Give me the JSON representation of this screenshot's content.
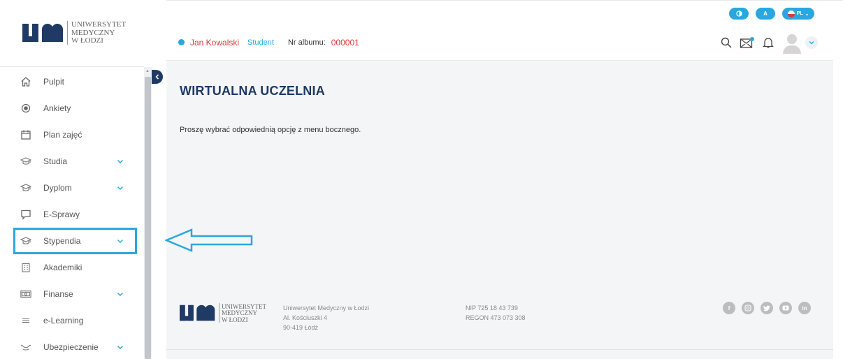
{
  "brand": {
    "logo_um": "um",
    "name_lines": [
      "UNIWERSYTET",
      "MEDYCZNY",
      "W ŁODZI"
    ]
  },
  "top_toggles": {
    "contrast_icon": "contrast-icon",
    "font_label": "A",
    "language": "PL"
  },
  "header": {
    "user_name": "Jan Kowalski",
    "user_role": "Student",
    "album_label": "Nr albumu:",
    "album_number": "000001",
    "icons": [
      "search-icon",
      "mail-icon",
      "bell-icon",
      "avatar"
    ]
  },
  "sidebar": {
    "items": [
      {
        "label": "Pulpit",
        "icon": "home-icon",
        "expandable": false
      },
      {
        "label": "Ankiety",
        "icon": "radio-icon",
        "expandable": false
      },
      {
        "label": "Plan zajęć",
        "icon": "calendar-icon",
        "expandable": false
      },
      {
        "label": "Studia",
        "icon": "graduation-cap-icon",
        "expandable": true
      },
      {
        "label": "Dyplom",
        "icon": "graduation-cap-icon",
        "expandable": true
      },
      {
        "label": "E-Sprawy",
        "icon": "chat-bubble-icon",
        "expandable": false
      },
      {
        "label": "Stypendia",
        "icon": "graduation-cap-icon",
        "expandable": true
      },
      {
        "label": "Akademiki",
        "icon": "building-icon",
        "expandable": false
      },
      {
        "label": "Finanse",
        "icon": "banknote-icon",
        "expandable": true
      },
      {
        "label": "e-Learning",
        "icon": "menu-lines-icon",
        "expandable": false
      },
      {
        "label": "Ubezpieczenie",
        "icon": "hands-icon",
        "expandable": true
      }
    ]
  },
  "main": {
    "title": "WIRTUALNA UCZELNIA",
    "message": "Proszę wybrać odpowiednią opcję z menu bocznego."
  },
  "footer": {
    "address": [
      "Uniwersytet Medyczny w Łodzi",
      "Al. Kościuszki 4",
      "90-419 Łódź"
    ],
    "registry": [
      "NIP 725 18 43 739",
      "REGON 473 073 308"
    ],
    "social": [
      "facebook-icon",
      "instagram-icon",
      "twitter-icon",
      "youtube-icon",
      "linkedin-icon"
    ]
  },
  "colors": {
    "accent": "#2aa7df",
    "navy": "#1f3a64",
    "red": "#d93a3a"
  }
}
